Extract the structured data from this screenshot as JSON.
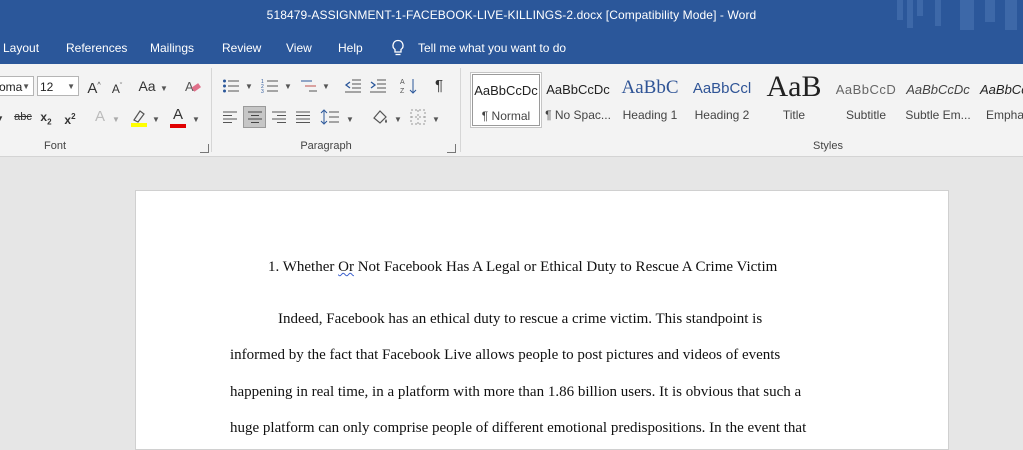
{
  "window": {
    "title": "518479-ASSIGNMENT-1-FACEBOOK-LIVE-KILLINGS-2.docx [Compatibility Mode]  -  Word"
  },
  "menu": {
    "tabs": [
      "Layout",
      "References",
      "Mailings",
      "Review",
      "View",
      "Help"
    ],
    "tell_me": "Tell me what you want to do"
  },
  "ribbon": {
    "font": {
      "font_name": "oma",
      "font_size": "12",
      "group_label": "Font",
      "grow_label": "A",
      "shrink_label": "A",
      "case_label": "Aa",
      "strike_label": "abc",
      "subscript_label": "x",
      "superscript_label": "x",
      "text_effects_label": "A",
      "font_color_label": "A",
      "highlight_color": "#ffff00",
      "font_color": "#e00000"
    },
    "paragraph": {
      "group_label": "Paragraph"
    },
    "styles": {
      "group_label": "Styles",
      "items": [
        {
          "sample": "AaBbCcDc",
          "name": "¶ Normal"
        },
        {
          "sample": "AaBbCcDc",
          "name": "¶ No Spac..."
        },
        {
          "sample": "AaBbC",
          "name": "Heading 1"
        },
        {
          "sample": "AaBbCcl",
          "name": "Heading 2"
        },
        {
          "sample": "AaB",
          "name": "Title"
        },
        {
          "sample": "AaBbCcD",
          "name": "Subtitle"
        },
        {
          "sample": "AaBbCcDc",
          "name": "Subtle Em..."
        },
        {
          "sample": "AaBbCc",
          "name": "Emphas"
        }
      ]
    }
  },
  "document": {
    "heading_number": "1.",
    "heading_word1": "Whether",
    "heading_word2": "Or",
    "heading_rest": "Not Facebook Has A Legal or Ethical Duty to Rescue A Crime Victim",
    "lines": [
      "Indeed, Facebook has an ethical duty to rescue a crime victim. This standpoint is",
      "informed by the fact that Facebook Live allows people to post pictures and videos of events",
      "happening in real time, in a platform with more than 1.86 billion users. It is obvious that such a",
      "huge platform can only comprise people of different emotional predispositions. In the event that"
    ]
  }
}
